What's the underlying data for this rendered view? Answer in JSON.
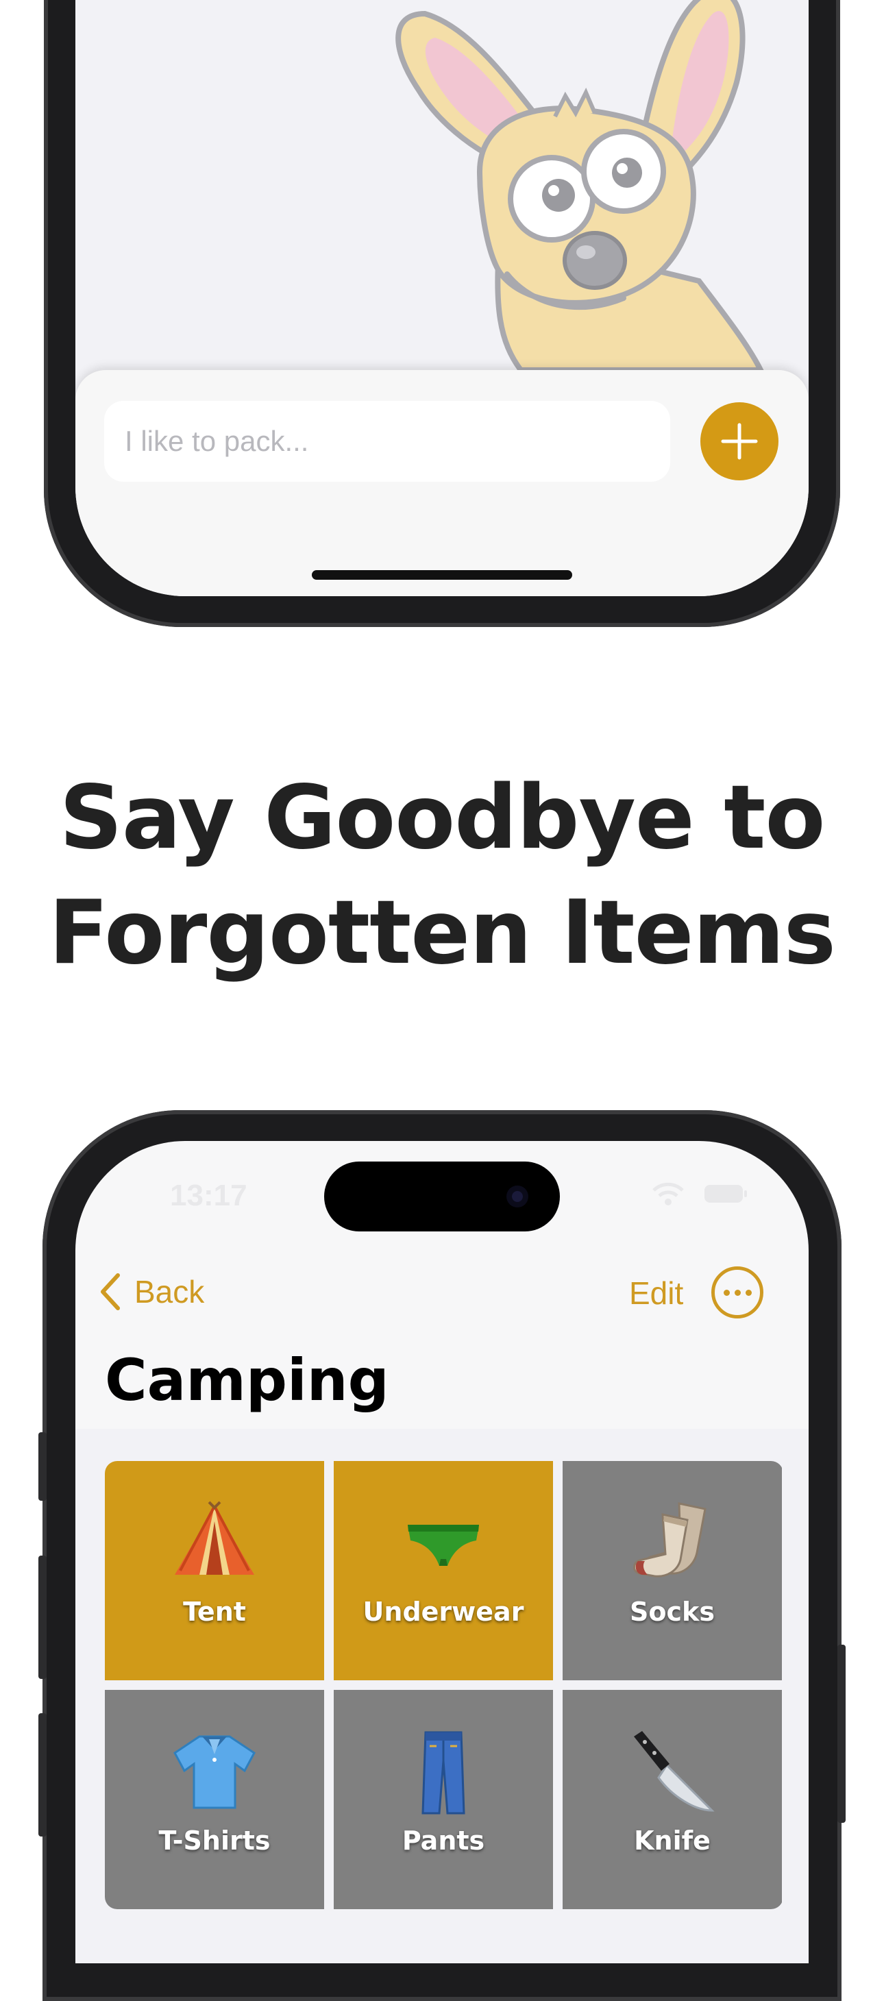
{
  "top_screen": {
    "input_placeholder": "I like to pack..."
  },
  "headline": {
    "line1": "Say Goodbye to",
    "line2": "Forgotten Items"
  },
  "bottom_screen": {
    "status_time": "13:17",
    "nav": {
      "back_label": "Back",
      "edit_label": "Edit"
    },
    "title": "Camping",
    "items": [
      {
        "label": "Tent",
        "state": "packed",
        "icon": "tent-icon"
      },
      {
        "label": "Underwear",
        "state": "packed",
        "icon": "underwear-icon"
      },
      {
        "label": "Socks",
        "state": "unpacked",
        "icon": "socks-icon"
      },
      {
        "label": "T-Shirts",
        "state": "unpacked",
        "icon": "tshirt-icon"
      },
      {
        "label": "Pants",
        "state": "unpacked",
        "icon": "pants-icon"
      },
      {
        "label": "Knife",
        "state": "unpacked",
        "icon": "knife-icon"
      }
    ]
  },
  "colors": {
    "accent": "#d49a15",
    "packed_tile": "#d09a18",
    "unpacked_tile": "#808080"
  }
}
